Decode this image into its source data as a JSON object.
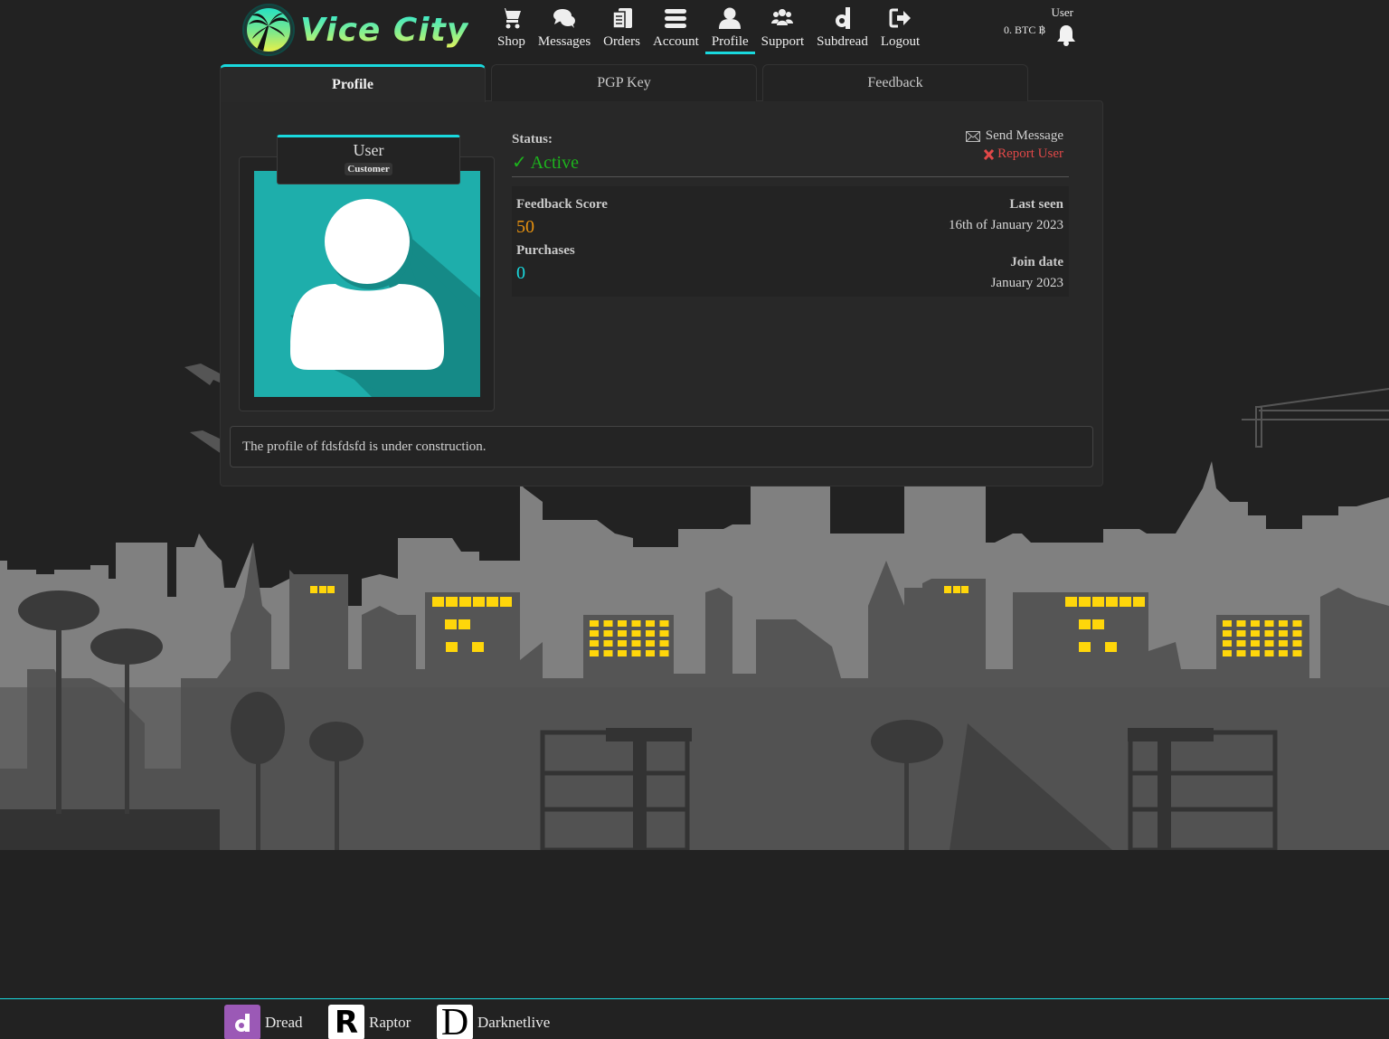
{
  "brand": {
    "name": "Vice City",
    "logo_icon": "palm-tree-logo-icon"
  },
  "nav": {
    "items": [
      {
        "label": "Shop",
        "icon": "cart-icon",
        "active": false
      },
      {
        "label": "Messages",
        "icon": "chat-bubbles-icon",
        "active": false
      },
      {
        "label": "Orders",
        "icon": "orders-document-icon",
        "active": false
      },
      {
        "label": "Account",
        "icon": "menu-bars-icon",
        "active": false
      },
      {
        "label": "Profile",
        "icon": "user-icon",
        "active": true
      },
      {
        "label": "Support",
        "icon": "users-group-icon",
        "active": false
      },
      {
        "label": "Subdread",
        "icon": "dread-d-icon",
        "active": false
      },
      {
        "label": "Logout",
        "icon": "sign-out-icon",
        "active": false
      }
    ]
  },
  "user_menu": {
    "username": "User",
    "balance": "0. BTC ฿",
    "notification_icon": "bell-icon"
  },
  "tabs": [
    {
      "label": "Profile",
      "active": true
    },
    {
      "label": "PGP Key",
      "active": false
    },
    {
      "label": "Feedback",
      "active": false
    }
  ],
  "profile": {
    "display_name": "User",
    "role": "Customer",
    "status_label": "Status:",
    "status_value": "✓ Active",
    "actions": {
      "send_message": "Send Message",
      "report_user": "Report User"
    },
    "stats": {
      "feedback_score_label": "Feedback Score",
      "feedback_score": "50",
      "purchases_label": "Purchases",
      "purchases": "0",
      "last_seen_label": "Last seen",
      "last_seen": "16th of January 2023",
      "join_date_label": "Join date",
      "join_date": "January 2023"
    },
    "note": "The profile of fdsfdsfd is under construction."
  },
  "footer": {
    "links": [
      {
        "label": "Dread",
        "badge": "d"
      },
      {
        "label": "Raptor",
        "badge": "R"
      },
      {
        "label": "Darknetlive",
        "badge": "D"
      }
    ]
  },
  "colors": {
    "accent": "#19d9de",
    "background": "#222222",
    "panel": "#282828",
    "status_active": "#1db31d",
    "report": "#e04848",
    "feedback_score": "#e8920f",
    "purchases": "#19d9de",
    "avatar_bg": "#1eaeab",
    "window_lights": "#ffd60a",
    "dread_badge": "#9b59b6"
  }
}
